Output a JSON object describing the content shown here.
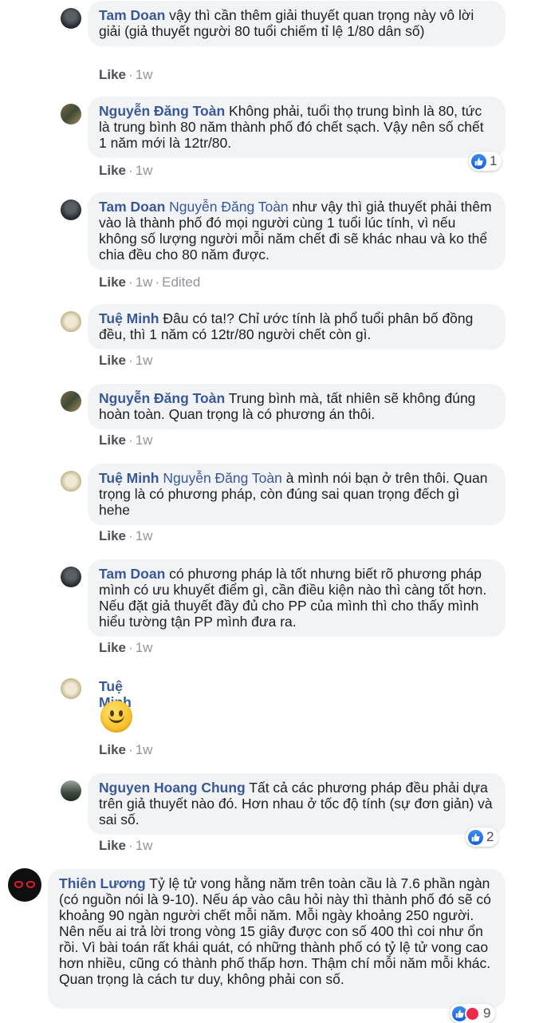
{
  "comments": [
    {
      "author": "Tam Doan",
      "tag": "",
      "text": " vậy thì cần thêm giải thuyết quan trọng này vô lời giải (giả thuyết người 80 tuổi chiếm tỉ lệ 1/80 dân số)",
      "like": "Like",
      "time": "1w",
      "edited": "",
      "reactions": ""
    },
    {
      "author": "Nguyễn Đăng Toàn",
      "tag": "",
      "text": " Không phải, tuổi thọ trung bình là 80, tức là trung bình 80 năm thành phố đó chết sạch. Vậy nên số chết 1 năm mới là 12tr/80.",
      "like": "Like",
      "time": "1w",
      "edited": "",
      "reactions": "1"
    },
    {
      "author": "Tam Doan",
      "tag": " Nguyễn Đăng Toàn",
      "text": " như vậy thì giả thuyết phải thêm vào là thành phố đó mọi người cùng 1 tuổi lúc tính, vì nếu không số lượng người mỗi năm chết đi sẽ khác nhau và ko thể chia đều cho 80 năm được.",
      "like": "Like",
      "time": "1w",
      "edited": "Edited",
      "reactions": ""
    },
    {
      "author": "Tuệ Minh",
      "tag": "",
      "text": " Đâu có ta!? Chỉ ước tính là phổ tuổi phân bố đồng đều, thì 1 năm có 12tr/80 người chết còn gì.",
      "like": "Like",
      "time": "1w",
      "edited": "",
      "reactions": ""
    },
    {
      "author": "Nguyễn Đăng Toàn",
      "tag": "",
      "text": " Trung bình mà, tất nhiên sẽ không đúng hoàn toàn. Quan trọng là có phương án thôi.",
      "like": "Like",
      "time": "1w",
      "edited": "",
      "reactions": ""
    },
    {
      "author": "Tuệ Minh",
      "tag": " Nguyễn Đăng Toàn",
      "text": " à mình nói bạn ở trên thôi. Quan trọng là có phương pháp, còn đúng sai quan trọng đếch gì hehe",
      "like": "Like",
      "time": "1w",
      "edited": "",
      "reactions": ""
    },
    {
      "author": "Tam Doan",
      "tag": "",
      "text": " có phương pháp là tốt nhưng biết rõ phương pháp mình có ưu khuyết điểm gì, cần điều kiện nào thì càng tốt hơn. Nếu đặt giả thuyết đầy đủ cho PP của mình thì cho thấy mình hiểu tường tận PP mình đưa ra.",
      "like": "Like",
      "time": "1w",
      "edited": "",
      "reactions": ""
    },
    {
      "author": "Tuệ Minh",
      "tag": "",
      "text": "",
      "like": "Like",
      "time": "1w",
      "edited": "",
      "reactions": "",
      "emoji": "smiling-face"
    },
    {
      "author": "Nguyen Hoang Chung",
      "tag": "",
      "text": " Tất cả các phương pháp đều phải dựa trên giả thuyết nào đó. Hơn nhau ở tốc độ tính (sự đơn giản) và sai số.",
      "like": "Like",
      "time": "1w",
      "edited": "",
      "reactions": "2"
    },
    {
      "author": "Thiên Lương",
      "tag": "",
      "text": " Tỷ lệ tử vong hằng năm trên toàn cầu là 7.6 phần ngàn (có nguồn nói là 9-10). Nếu áp vào câu hỏi này thì thành phố đó sẽ có khoảng 90 ngàn người chết mỗi năm. Mỗi ngày khoảng 250 người. Nên nếu ai trả lời trong vòng 15 giây được con số 400 thì coi như ổn rồi. Vì bài toán rất khái quát, có những thành phố có tỷ lệ tử vong cao hơn nhiều, cũng có thành phố thấp hơn. Thậm chí mỗi năm mỗi khác. Quan trọng là cách tư duy, không phải con số.",
      "like": "",
      "time": "",
      "edited": "",
      "reactions": "9"
    }
  ],
  "colors": {
    "link": "#385898",
    "bubble": "#f2f3f5",
    "meta": "#90949c",
    "like_blue": "#1461d8",
    "heart": "#f0284a"
  }
}
